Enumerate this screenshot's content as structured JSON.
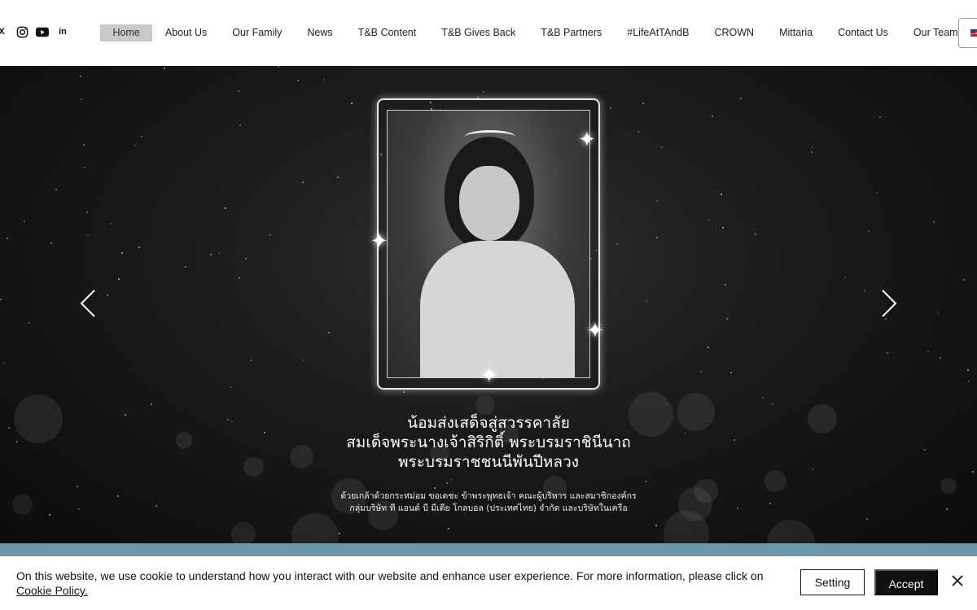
{
  "header": {
    "social": [
      {
        "icon": "x-icon",
        "glyph": "X"
      },
      {
        "icon": "instagram-icon",
        "glyph": "◎"
      },
      {
        "icon": "youtube-icon",
        "glyph": "▶"
      },
      {
        "icon": "linkedin-icon",
        "glyph": "in"
      }
    ],
    "nav": [
      {
        "label": "Home",
        "active": true
      },
      {
        "label": "About Us"
      },
      {
        "label": "Our Family"
      },
      {
        "label": "News"
      },
      {
        "label": "T&B Content"
      },
      {
        "label": "T&B Gives Back"
      },
      {
        "label": "T&B Partners"
      },
      {
        "label": "#LifeAtTAndB"
      },
      {
        "label": "CROWN"
      },
      {
        "label": "Mittaria"
      },
      {
        "label": "Contact Us"
      },
      {
        "label": "Our Team"
      }
    ],
    "language_icon": "us-flag-icon"
  },
  "hero": {
    "title_line1": "น้อมส่งเสด็จสู่สวรรคาลัย",
    "title_line2": "สมเด็จพระนางเจ้าสิริกิติ์ พระบรมราชินีนาถ",
    "title_line3": "พระบรมราชชนนีพันปีหลวง",
    "sub_line1": "ด้วยเกล้าด้วยกระหม่อม ขอเดชะ ข้าพระพุทธเจ้า คณะผู้บริหาร และสมาชิกองค์กร",
    "sub_line2": "กลุ่มบริษัท ที แอนด์ บี มีเดีย โกลบอล (ประเทศไทย) จำกัด และบริษัทในเครือ",
    "prev_icon": "chevron-left-icon",
    "next_icon": "chevron-right-icon"
  },
  "cookie": {
    "text": "On this website, we use cookie to understand how you interact with our website and enhance user experience. For more information, please click on ",
    "link": "Cookie Policy.",
    "setting_label": "Setting",
    "accept_label": "Accept",
    "close_icon": "close-icon"
  },
  "colors": {
    "nav_active_bg": "#c9c9c9",
    "banner_blue": "#6e97ad",
    "accept_bg": "#111111"
  }
}
